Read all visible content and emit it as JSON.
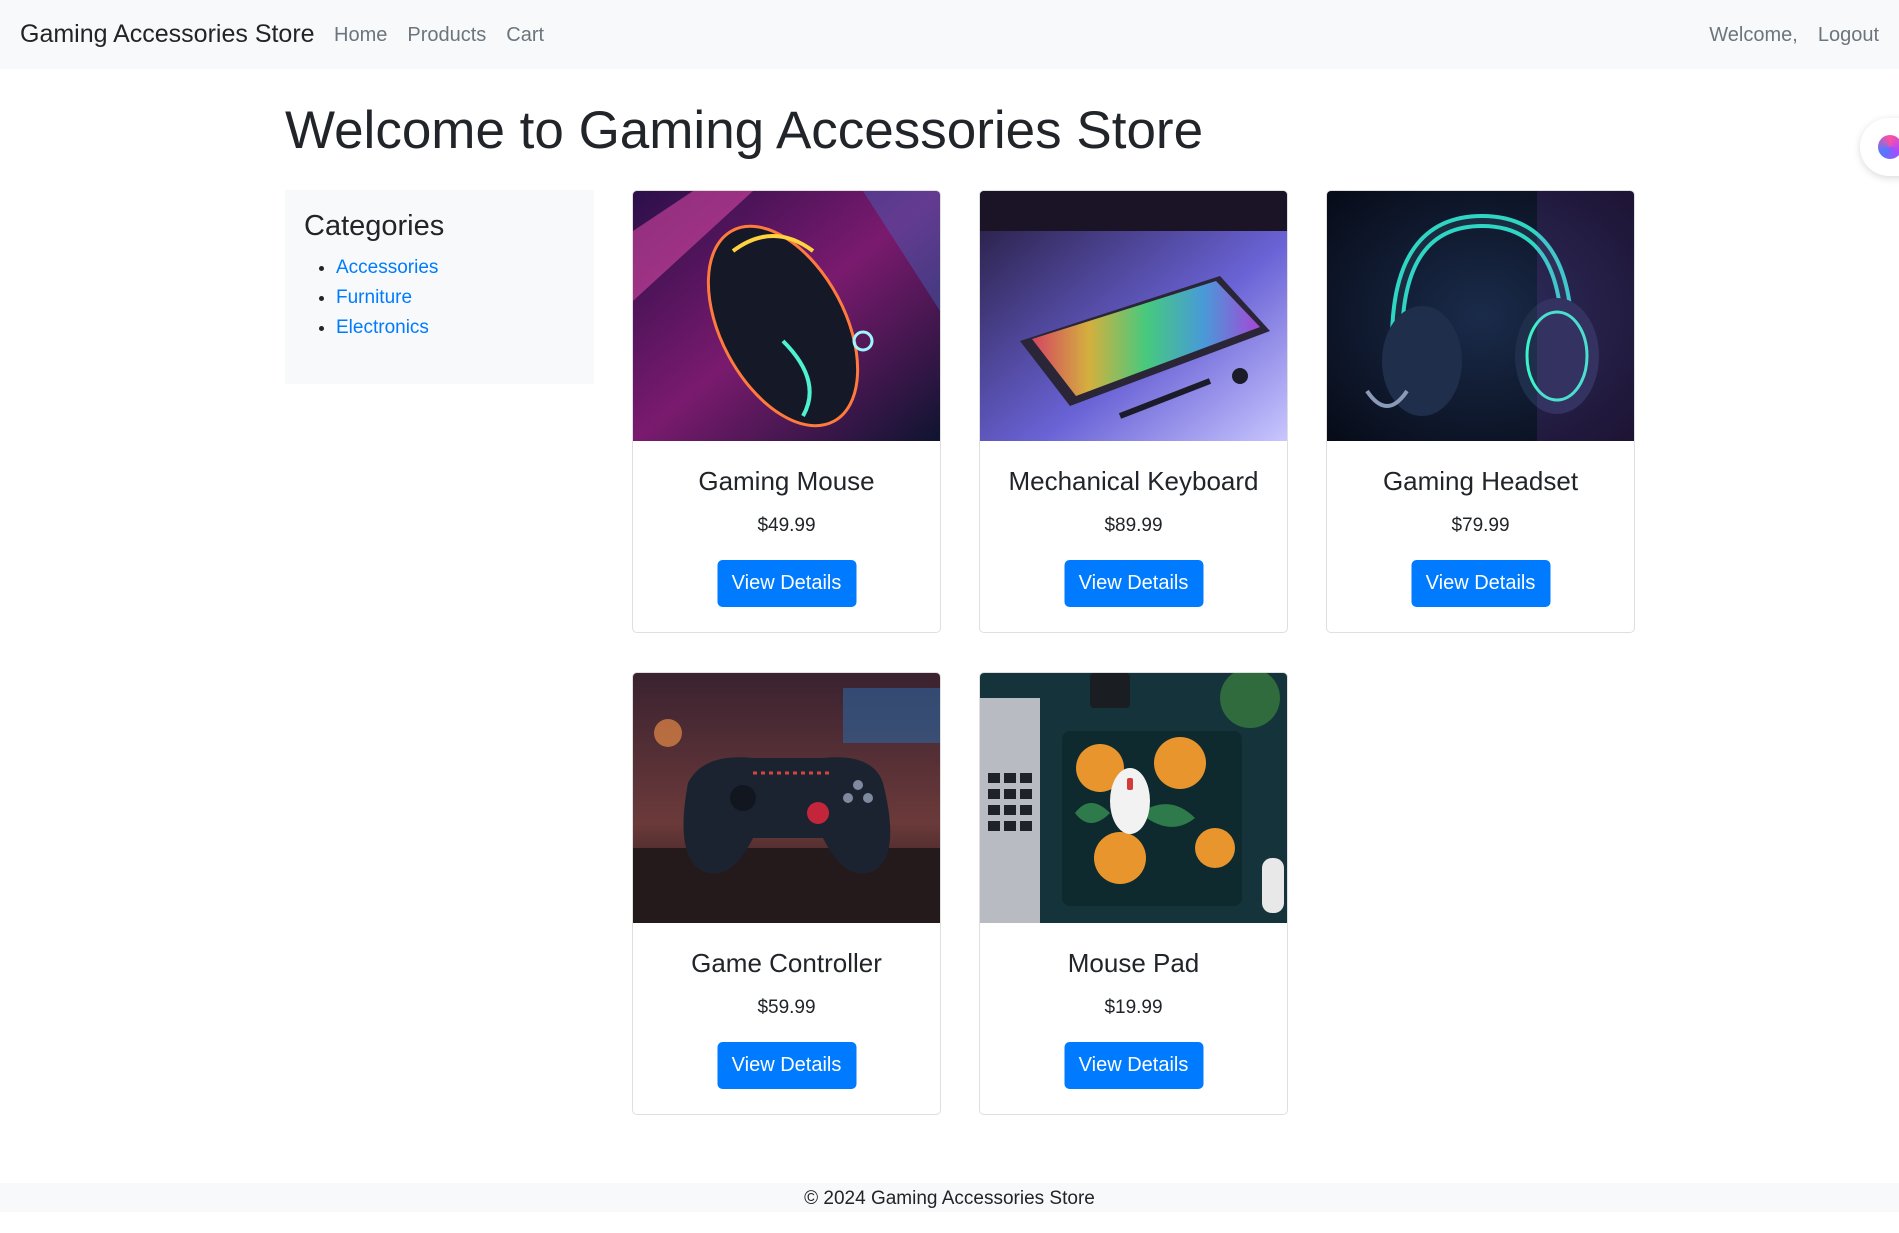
{
  "navbar": {
    "brand": "Gaming Accessories Store",
    "links": [
      "Home",
      "Products",
      "Cart"
    ],
    "welcome": "Welcome,",
    "logout": "Logout"
  },
  "page": {
    "title": "Welcome to Gaming Accessories Store"
  },
  "sidebar": {
    "heading": "Categories",
    "categories": [
      "Accessories",
      "Furniture",
      "Electronics"
    ]
  },
  "products": [
    {
      "name": "Gaming Mouse",
      "price": "$49.99",
      "button": "View Details",
      "image_icon": "gaming-mouse-image"
    },
    {
      "name": "Mechanical Keyboard",
      "price": "$89.99",
      "button": "View Details",
      "image_icon": "mechanical-keyboard-image"
    },
    {
      "name": "Gaming Headset",
      "price": "$79.99",
      "button": "View Details",
      "image_icon": "gaming-headset-image"
    },
    {
      "name": "Game Controller",
      "price": "$59.99",
      "button": "View Details",
      "image_icon": "game-controller-image"
    },
    {
      "name": "Mouse Pad",
      "price": "$19.99",
      "button": "View Details",
      "image_icon": "mouse-pad-image"
    }
  ],
  "footer": {
    "text": "© 2024 Gaming Accessories Store"
  },
  "colors": {
    "primary": "#007bff",
    "navbar_bg": "#f8f9fa",
    "muted": "#6c757d"
  }
}
